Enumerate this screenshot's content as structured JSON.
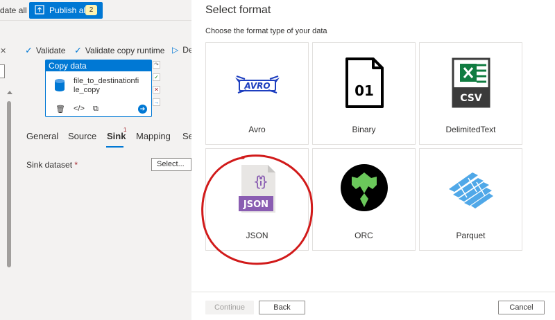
{
  "toolbar": {
    "validate_all_partial": "date all",
    "publish_label": "Publish all",
    "publish_count": "2"
  },
  "pipeline_toolbar": {
    "validate_label": "Validate",
    "validate_copy_runtime_label": "Validate copy runtime",
    "debug_partial": "De"
  },
  "activity": {
    "header": "Copy data",
    "name_line1": "file_to_destinationfi",
    "name_line2": "le_copy"
  },
  "tabs": [
    {
      "label": "General"
    },
    {
      "label": "Source"
    },
    {
      "label": "Sink",
      "badge": "1"
    },
    {
      "label": "Mapping"
    },
    {
      "label": "Se"
    }
  ],
  "sink": {
    "dataset_label": "Sink dataset",
    "required_mark": "*",
    "select_placeholder": "Select..."
  },
  "modal": {
    "title": "Select format",
    "subtitle": "Choose the format type of your data",
    "formats": [
      {
        "label": "Avro",
        "icon": "avro-logo-icon"
      },
      {
        "label": "Binary",
        "icon": "binary-file-icon",
        "icon_text": "01"
      },
      {
        "label": "DelimitedText",
        "icon": "csv-file-icon",
        "icon_text": "CSV"
      },
      {
        "label": "JSON",
        "icon": "json-file-icon",
        "icon_text": "JSON"
      },
      {
        "label": "ORC",
        "icon": "orc-logo-icon"
      },
      {
        "label": "Parquet",
        "icon": "parquet-logo-icon"
      }
    ],
    "buttons": {
      "continue": "Continue",
      "back": "Back",
      "cancel": "Cancel"
    }
  },
  "colors": {
    "accent": "#0078d4",
    "annotation": "#d11a1a",
    "json_purple": "#8a5db2",
    "csv_green": "#107c41"
  }
}
